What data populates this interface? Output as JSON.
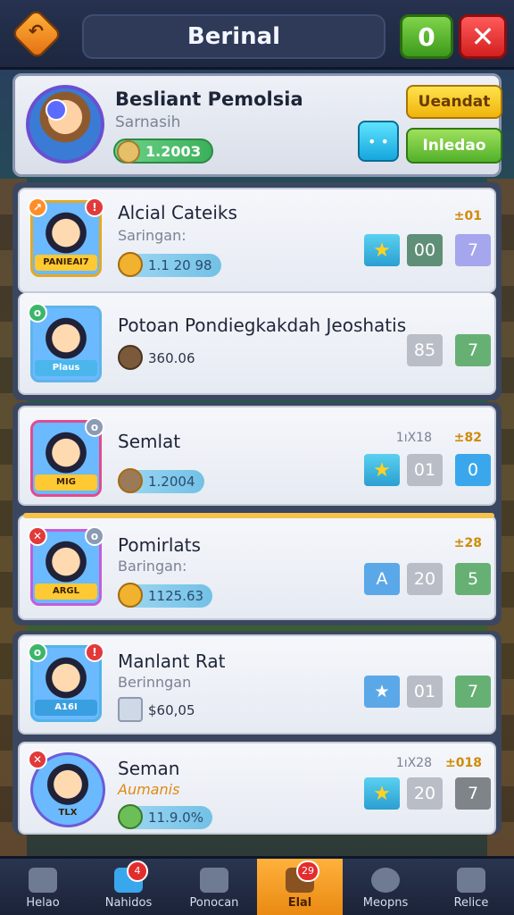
{
  "topbar": {
    "title": "Berinal",
    "counter": "0",
    "close_glyph": "✕"
  },
  "profile": {
    "name": "Besliant Pemolsia",
    "subtitle": "Sarnasih",
    "coins": "1.200З",
    "emote_glyph": "• •",
    "btn_top": "Ueandat",
    "btn_bottom": "Inledao"
  },
  "players": [
    {
      "name": "Alcial Cateiks",
      "subtitle": "Saringan:",
      "chip": "1.1 20 98",
      "plate": "PANIEAI7",
      "rank_label": "±01",
      "cells": [
        "★",
        "00",
        "7"
      ]
    },
    {
      "name": "Potoan Pondiegkakdah Jeoshatis",
      "subtitle": "",
      "chip": "360.06",
      "plate": "Plaus",
      "rank_label": "",
      "cells": [
        "",
        "85",
        "7"
      ]
    },
    {
      "name": "Semlat",
      "subtitle": "",
      "chip": "1.2004",
      "plate": "MIG",
      "rank_label": "±82",
      "rank_grey": "1ıX18",
      "cells": [
        "★",
        "01",
        "0"
      ]
    },
    {
      "name": "Pomirlats",
      "subtitle": "Baringan:",
      "chip": "1125.63",
      "plate": "ARGL",
      "rank_label": "±28",
      "cells": [
        "A",
        "20",
        "5"
      ]
    },
    {
      "name": "Manlant Rat",
      "subtitle": "Berinngan",
      "chip": "$60,05",
      "plate": "A16I",
      "rank_label": "",
      "cells": [
        "★",
        "01",
        "7"
      ]
    },
    {
      "name": "Seman",
      "subtitle": "Aumanis",
      "chip": "11.9.0%",
      "plate": "TLX",
      "rank_label": "±018",
      "rank_grey": "1ıX28",
      "cells": [
        "★",
        "20",
        "7"
      ]
    }
  ],
  "nav": [
    {
      "label": "Helao",
      "icon": "home-icon",
      "badge": ""
    },
    {
      "label": "Nahidos",
      "icon": "chart-icon",
      "badge": "4"
    },
    {
      "label": "Ponocan",
      "icon": "users-icon",
      "badge": ""
    },
    {
      "label": "Elal",
      "icon": "gift-icon",
      "badge": "29"
    },
    {
      "label": "Meopns",
      "icon": "gear-icon",
      "badge": ""
    },
    {
      "label": "Relice",
      "icon": "menu-icon",
      "badge": ""
    }
  ]
}
